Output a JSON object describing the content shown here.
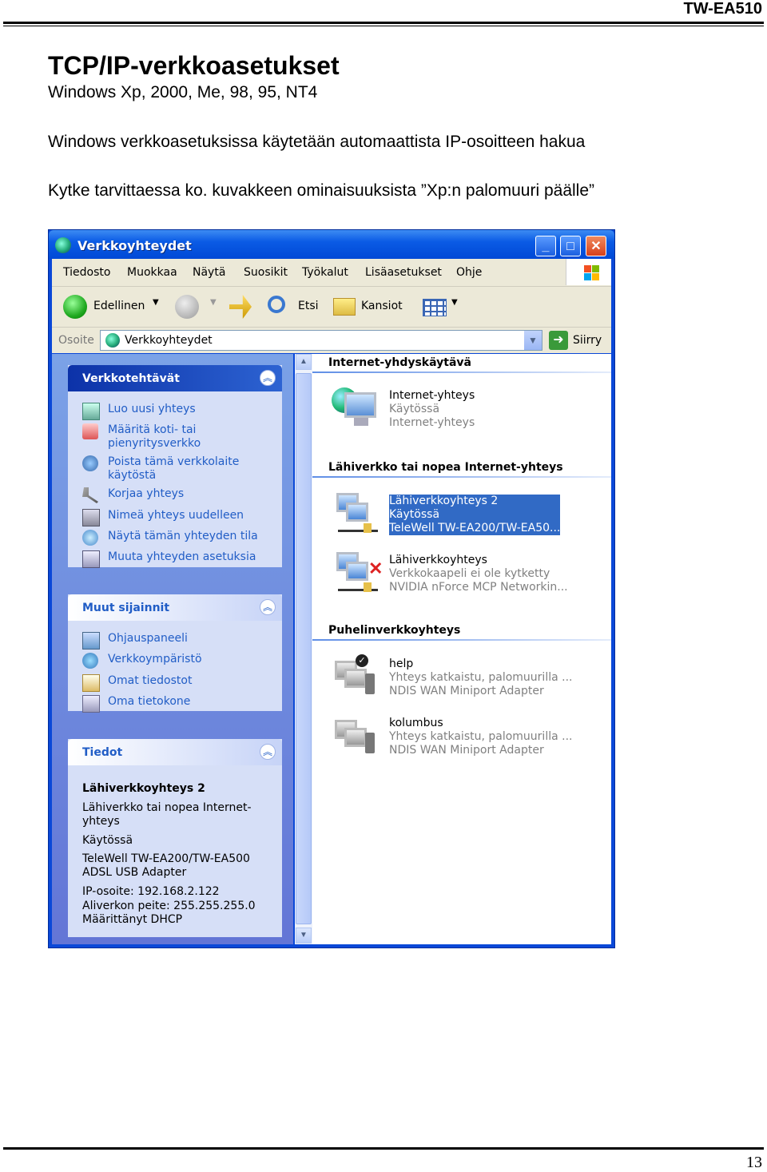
{
  "header": {
    "model": "TW-EA510"
  },
  "doc": {
    "title": "TCP/IP-verkkoasetukset",
    "subtitle": "Windows Xp, 2000, Me, 98, 95, NT4",
    "para1": "Windows verkkoasetuksissa käytetään automaattista IP-osoitteen hakua",
    "para2": "Kytke tarvittaessa ko. kuvakkeen ominaisuuksista ”Xp:n palomuuri päälle”"
  },
  "window": {
    "title": "Verkkoyhteydet",
    "buttons": {
      "minimize": "_",
      "maximize": "□",
      "close": "✕"
    },
    "menu": [
      "Tiedosto",
      "Muokkaa",
      "Näytä",
      "Suosikit",
      "Työkalut",
      "Lisäasetukset",
      "Ohje"
    ],
    "toolbar": {
      "back": "Edellinen",
      "search": "Etsi",
      "folders": "Kansiot"
    },
    "address": {
      "label": "Osoite",
      "value": "Verkkoyhteydet",
      "go": "Siirry"
    },
    "tasks": {
      "title": "Verkkotehtävät",
      "items": [
        "Luo uusi yhteys",
        "Määritä koti- tai pienyritysverkko",
        "Poista tämä verkkolaite käytöstä",
        "Korjaa yhteys",
        "Nimeä yhteys uudelleen",
        "Näytä tämän yhteyden tila",
        "Muuta yhteyden asetuksia"
      ]
    },
    "places": {
      "title": "Muut sijainnit",
      "items": [
        "Ohjauspaneeli",
        "Verkkoympäristö",
        "Omat tiedostot",
        "Oma tietokone"
      ]
    },
    "details": {
      "title": "Tiedot",
      "name": "Lähiverkkoyhteys 2",
      "type": "Lähiverkko tai nopea Internet-yhteys",
      "status": "Käytössä",
      "adapter": "TeleWell TW-EA200/TW-EA500 ADSL USB Adapter",
      "ip": "IP-osoite: 192.168.2.122",
      "mask": "Aliverkon peite: 255.255.255.0",
      "dhcp": "Määrittänyt DHCP"
    },
    "groups": [
      {
        "title": "Internet-yhdyskäytävä",
        "items": [
          {
            "name": "Internet-yhteys",
            "status": "Käytössä",
            "device": "Internet-yhteys"
          }
        ]
      },
      {
        "title": "Lähiverkko tai nopea Internet-yhteys",
        "items": [
          {
            "name": "Lähiverkkoyhteys 2",
            "status": "Käytössä",
            "device": "TeleWell TW-EA200/TW-EA50..."
          },
          {
            "name": "Lähiverkkoyhteys",
            "status": "Verkkokaapeli ei ole kytketty",
            "device": "NVIDIA nForce MCP Networkin..."
          }
        ]
      },
      {
        "title": "Puhelinverkkoyhteys",
        "items": [
          {
            "name": "help",
            "status": "Yhteys katkaistu, palomuurilla ...",
            "device": "NDIS WAN Miniport Adapter"
          },
          {
            "name": "kolumbus",
            "status": "Yhteys katkaistu, palomuurilla ...",
            "device": "NDIS WAN Miniport Adapter"
          }
        ]
      }
    ]
  },
  "footer": {
    "page": "13"
  }
}
